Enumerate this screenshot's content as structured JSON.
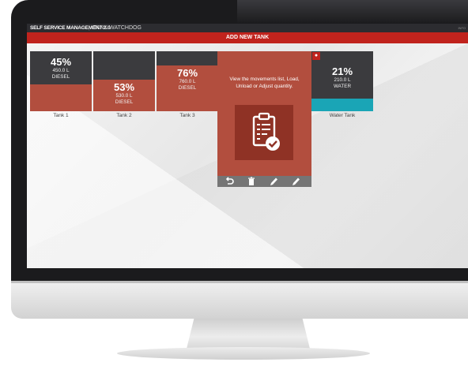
{
  "header": {
    "brand": "SELF SERVICE MANAGEMENT 2.0",
    "separator": "|",
    "app_name": "TANK WATCHDOG",
    "right_text": "INFO"
  },
  "add_button": {
    "label": "ADD NEW TANK"
  },
  "tanks": [
    {
      "name": "Tank 1",
      "percent": "45%",
      "volume": "450.0 L",
      "fuel": "DIESEL",
      "level": 0.45
    },
    {
      "name": "Tank 2",
      "percent": "53%",
      "volume": "530.0 L",
      "fuel": "DIESEL",
      "level": 0.53
    },
    {
      "name": "Tank 3",
      "percent": "76%",
      "volume": "760.0 L",
      "fuel": "DIESEL",
      "level": 0.76
    },
    {
      "name": "Water Tank",
      "percent": "21%",
      "volume": "210.0 L",
      "fuel": "WATER",
      "level": 0.21
    }
  ],
  "popup": {
    "text": "View the movements list, Load, Unload or Adjust quantity.",
    "icon": "clipboard-check-icon",
    "actions": [
      {
        "icon": "undo-icon"
      },
      {
        "icon": "trash-icon"
      },
      {
        "icon": "pencil-icon"
      },
      {
        "icon": "pencil-icon"
      }
    ]
  },
  "colors": {
    "accent_red": "#c0231d",
    "tank_fill": "#b24e3e",
    "tank_empty": "#3b3b3e",
    "water": "#1aa5b6"
  }
}
